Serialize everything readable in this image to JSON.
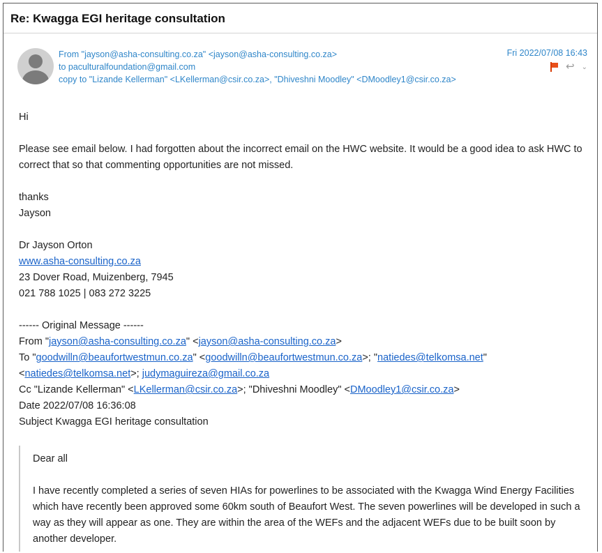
{
  "subject": "Re: Kwagga EGI heritage consultation",
  "header": {
    "from": "From \"jayson@asha-consulting.co.za\" <jayson@asha-consulting.co.za>",
    "to": "to paculturalfoundation@gmail.com",
    "copy": "copy to \"Lizande Kellerman\" <LKellerman@csir.co.za>, \"Dhiveshni Moodley\" <DMoodley1@csir.co.za>",
    "date": "Fri 2022/07/08 16:43"
  },
  "icons": {
    "flag": "flag-icon",
    "reply": "reply-arrow-icon",
    "more": "chevron-down-icon",
    "avatar": "person-avatar-icon"
  },
  "colors": {
    "header_link": "#2f86c9",
    "link": "#1a63c9",
    "flag": "#e8501b"
  },
  "body": {
    "greeting": "Hi",
    "paragraph": "Please see email below. I had forgotten about the incorrect email on the HWC website. It would be a good idea to ask HWC to correct that so that commenting opportunities are not missed.",
    "thanks": "thanks",
    "name": "Jayson",
    "signature": {
      "name": "Dr Jayson Orton",
      "website": "www.asha-consulting.co.za",
      "address": "23 Dover Road, Muizenberg, 7945",
      "phone": "021 788 1025 | 083 272 3225"
    }
  },
  "original": {
    "separator": "------ Original Message ------",
    "from_label": "From \"",
    "from_email": "jayson@asha-consulting.co.za",
    "from_mid": "\" <",
    "from_email2": "jayson@asha-consulting.co.za",
    "from_end": ">",
    "to_label": "To \"",
    "to_email1": "goodwilln@beaufortwestmun.co.za",
    "to_mid1": "\" <",
    "to_email2": "goodwilln@beaufortwestmun.co.za",
    "to_mid2": ">; \"",
    "to_email3": "natiedes@telkomsa.net",
    "to_mid3": "\"",
    "to_lt": "<",
    "to_email4": "natiedes@telkomsa.net",
    "to_mid4": ">; ",
    "to_email5": "judymaguireza@gmail.co.za",
    "cc_label": "Cc \"Lizande Kellerman\" <",
    "cc_email1": "LKellerman@csir.co.za",
    "cc_mid": ">; \"Dhiveshni Moodley\" <",
    "cc_email2": "DMoodley1@csir.co.za",
    "cc_end": ">",
    "date": "Date 2022/07/08 16:36:08",
    "subject": "Subject Kwagga EGI heritage consultation"
  },
  "quote": {
    "greeting": "Dear all",
    "paragraph": "I have recently completed a series of seven HIAs for powerlines to be associated with the Kwagga Wind Energy Facilities which have recently been approved some 60km south of Beaufort West. The seven powerlines will be developed in such a way as they will appear as one. They are within the area of the WEFs and the adjacent WEFs due to be built soon by another developer."
  }
}
